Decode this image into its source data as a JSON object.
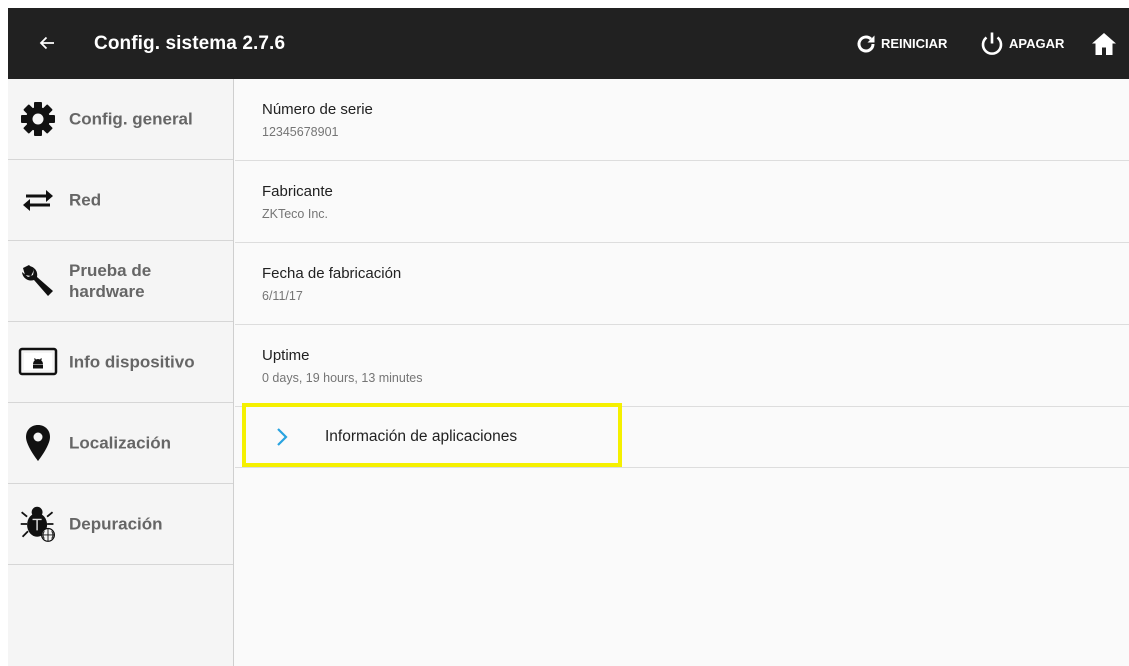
{
  "header": {
    "title": "Config. sistema 2.7.6",
    "reboot_label": "REINICIAR",
    "power_label": "APAGAR",
    "background_color": "#212121"
  },
  "sidebar": {
    "items": [
      {
        "label": "Config. general",
        "icon": "gear-icon"
      },
      {
        "label": "Red",
        "icon": "swap-arrows-icon"
      },
      {
        "label": "Prueba de hardware",
        "icon": "wrench-icon"
      },
      {
        "label": "Info dispositivo",
        "icon": "android-device-icon"
      },
      {
        "label": "Localización",
        "icon": "location-pin-icon"
      },
      {
        "label": "Depuración",
        "icon": "bug-icon"
      }
    ]
  },
  "content": {
    "rows": [
      {
        "title": "Número de serie",
        "value": "12345678901"
      },
      {
        "title": "Fabricante",
        "value": "ZKTeco Inc."
      },
      {
        "title": "Fecha de fabricación",
        "value": "6/11/17"
      },
      {
        "title": "Uptime",
        "value": "0 days, 19 hours, 13 minutes"
      }
    ],
    "apps_link": {
      "label": "Información de aplicaciones",
      "chevron_color": "#29a3e0"
    }
  },
  "highlight_color": "#f5f000"
}
